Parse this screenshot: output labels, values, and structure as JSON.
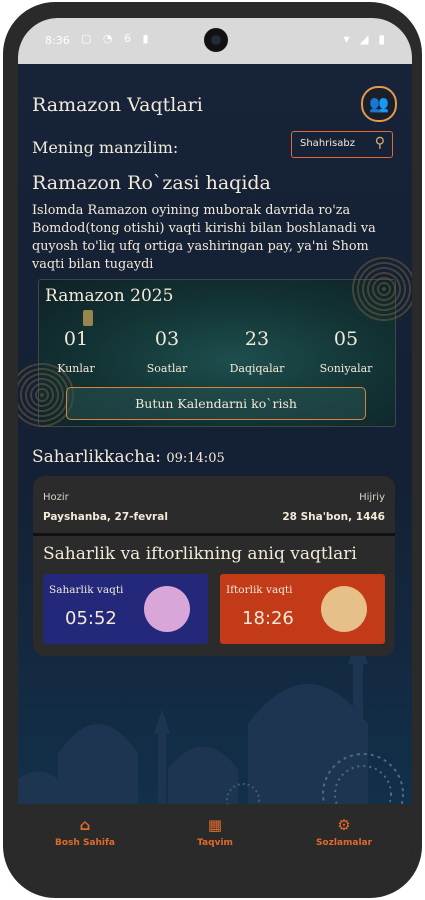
{
  "status_bar": {
    "time": "8:36",
    "icons_left": "▢ ◔ 6 ▮",
    "icons_right": "▾ ◢ ▮"
  },
  "header": {
    "title": "Ramazon Vaqtlari"
  },
  "location": {
    "label": "Mening manzilim:",
    "value": "Shahrisabz"
  },
  "about": {
    "title": "Ramazon Ro`zasi haqida",
    "text": "Islomda Ramazon oyining muborak davrida ro'za Bomdod(tong otishi) vaqti kirishi bilan boshlanadi va quyosh to'liq ufq ortiga yashiringan pay, ya'ni Shom vaqti bilan tugaydi"
  },
  "countdown": {
    "title": "Ramazon 2025",
    "units": [
      {
        "value": "01",
        "label": "Kunlar"
      },
      {
        "value": "03",
        "label": "Soatlar"
      },
      {
        "value": "23",
        "label": "Daqiqalar"
      },
      {
        "value": "05",
        "label": "Soniyalar"
      }
    ],
    "calendar_button": "Butun Kalendarni ko`rish"
  },
  "saharlik": {
    "label": "Saharlikkacha:",
    "value": "09:14:05"
  },
  "date_card": {
    "left_label": "Hozir",
    "left_value": "Payshanba, 27-fevral",
    "right_label": "Hijriy",
    "right_value": "28 Sha'bon, 1446",
    "times_title": "Saharlik va iftorlikning aniq vaqtlari",
    "saharlik": {
      "label": "Saharlik vaqti",
      "time": "05:52",
      "color": "#23287a"
    },
    "iftorlik": {
      "label": "Iftorlik vaqti",
      "time": "18:26",
      "color": "#c23a18"
    }
  },
  "nav": [
    {
      "label": "Bosh Sahifa",
      "icon": "home-icon"
    },
    {
      "label": "Taqvim",
      "icon": "calendar-icon"
    },
    {
      "label": "Sozlamalar",
      "icon": "settings-icon"
    }
  ],
  "colors": {
    "accent": "#e06a2a",
    "background": "#162338",
    "card": "#2b2b2b"
  }
}
